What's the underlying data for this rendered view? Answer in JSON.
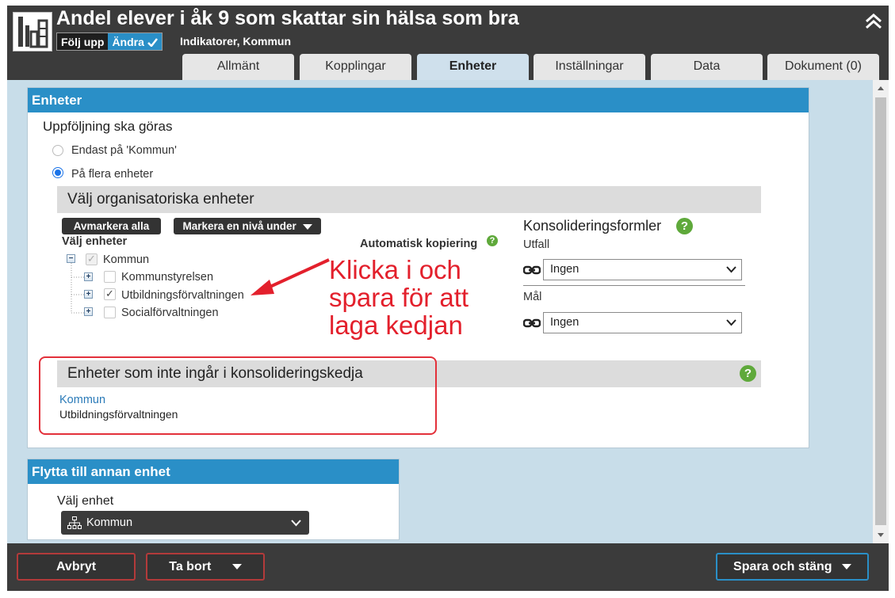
{
  "header": {
    "title": "Andel elever i åk 9 som skattar sin hälsa som bra",
    "mode_follow": "Följ upp",
    "mode_edit": "Ändra",
    "subtitle": "Indikatorer, Kommun",
    "tabs": [
      {
        "label": "Allmänt",
        "active": false
      },
      {
        "label": "Kopplingar",
        "active": false
      },
      {
        "label": "Enheter",
        "active": true
      },
      {
        "label": "Inställningar",
        "active": false
      },
      {
        "label": "Data",
        "active": false
      },
      {
        "label": "Dokument (0)",
        "active": false
      }
    ]
  },
  "enheter": {
    "heading": "Enheter",
    "followup_title": "Uppföljning ska göras",
    "radio_only": "Endast på 'Kommun'",
    "radio_many": "På flera enheter",
    "org_section": "Välj organisatoriska enheter",
    "btn_unmark_all": "Avmarkera alla",
    "btn_mark_level": "Markera en nivå under",
    "select_units_label": "Välj enheter",
    "auto_copy_label": "Automatisk kopiering",
    "tree": {
      "root": "Kommun",
      "children": [
        "Kommunstyrelsen",
        "Utbildningsförvaltningen",
        "Socialförvaltningen"
      ]
    },
    "consolidation": {
      "title": "Konsolideringsformler",
      "outcome_label": "Utfall",
      "outcome_value": "Ingen",
      "goal_label": "Mål",
      "goal_value": "Ingen"
    },
    "not_in_chain_section": "Enheter som inte ingår i konsolideringskedja",
    "not_in_chain_link": "Kommun",
    "not_in_chain_item": "Utbildningsförvaltningen"
  },
  "annotation": {
    "line1": "Klicka i och",
    "line2": "spara för att",
    "line3": "laga kedjan",
    "color": "#e3202c"
  },
  "move": {
    "heading": "Flytta till annan enhet",
    "label": "Välj enhet",
    "value": "Kommun"
  },
  "footer": {
    "cancel": "Avbryt",
    "delete": "Ta bort",
    "save_close": "Spara och stäng"
  },
  "colors": {
    "accent": "#2a8fc7",
    "help": "#5fa93b",
    "dark": "#3b3b3b"
  }
}
